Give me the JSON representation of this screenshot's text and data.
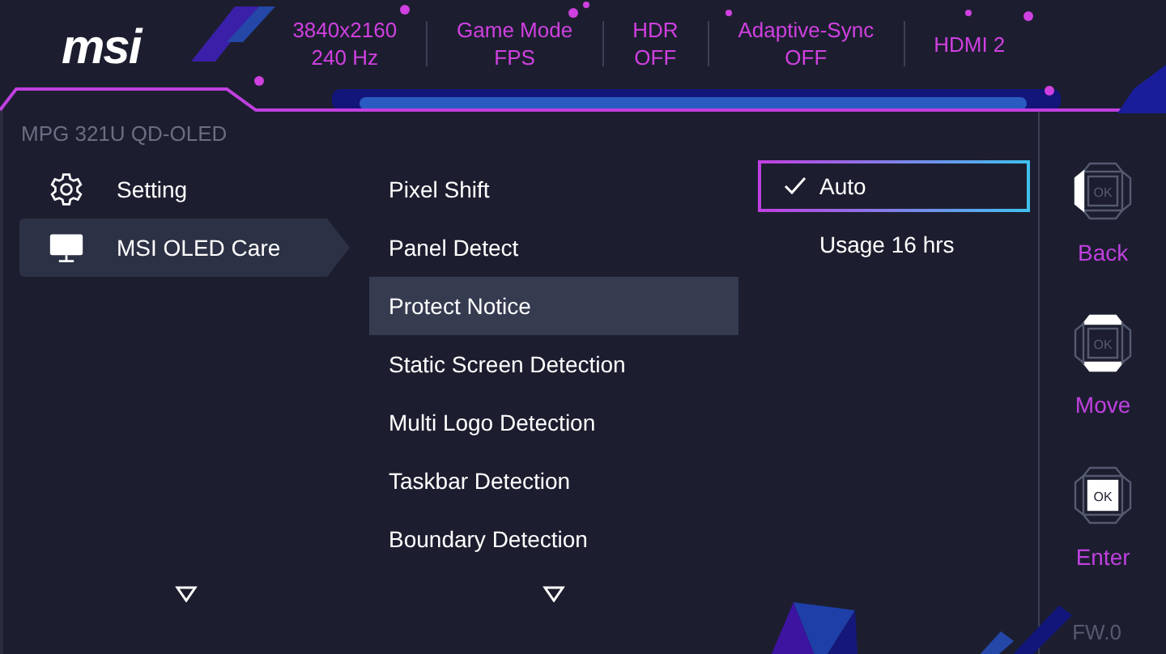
{
  "header": {
    "logo": "msi",
    "status": [
      {
        "value": "3840x2160",
        "detail": "240 Hz"
      },
      {
        "value": "Game Mode",
        "detail": "FPS"
      },
      {
        "value": "HDR",
        "detail": "OFF"
      },
      {
        "value": "Adaptive-Sync",
        "detail": "OFF"
      },
      {
        "value": "HDMI 2"
      }
    ]
  },
  "model": "MPG 321U QD-OLED",
  "sidebar": {
    "items": [
      {
        "label": "Setting",
        "kind": "gear",
        "selected": false
      },
      {
        "label": "MSI OLED Care",
        "kind": "monitor",
        "selected": true
      }
    ]
  },
  "menu": {
    "items": [
      {
        "label": "Pixel Shift",
        "selected": false
      },
      {
        "label": "Panel Detect",
        "selected": false
      },
      {
        "label": "Protect Notice",
        "selected": true
      },
      {
        "label": "Static Screen Detection",
        "selected": false
      },
      {
        "label": "Multi Logo Detection",
        "selected": false
      },
      {
        "label": "Taskbar Detection",
        "selected": false
      },
      {
        "label": "Boundary Detection",
        "selected": false
      }
    ]
  },
  "options": [
    {
      "label": "Auto",
      "checked": true,
      "selected": true
    },
    {
      "label": "Usage 16 hrs",
      "checked": false,
      "selected": false
    }
  ],
  "nav": [
    {
      "label": "Back",
      "key": "OK",
      "kind": "back"
    },
    {
      "label": "Move",
      "key": "OK",
      "kind": "move"
    },
    {
      "label": "Enter",
      "key": "OK",
      "kind": "enter"
    }
  ],
  "firmware": "FW.0"
}
